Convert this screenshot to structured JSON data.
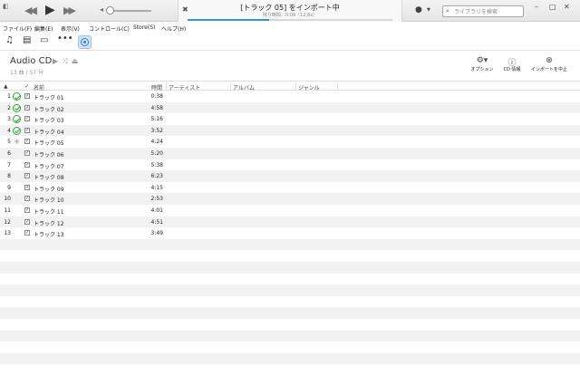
{
  "player": {
    "lcd_title": "[トラック 05] をインポート中",
    "lcd_subtitle": "残り時間：0:09（12.6x）",
    "progress_percent": 40,
    "search_placeholder": "ライブラリを検索"
  },
  "menu": [
    {
      "label": "ファイル(F)"
    },
    {
      "label": "編集(E)"
    },
    {
      "label": "表示(V)"
    },
    {
      "label": "コントロール(C)"
    },
    {
      "label": "Store(S)"
    },
    {
      "label": "ヘルプ(H)"
    }
  ],
  "album": {
    "title": "Audio CD",
    "subtitle": "13 曲 / 57 分"
  },
  "actions": {
    "options": "オプション",
    "cd_info": "CD 情報",
    "stop_import": "インポートを中止"
  },
  "columns": {
    "check": "✓",
    "name": "名前",
    "time": "時間",
    "artist": "アーティスト",
    "album": "アルバム",
    "genre": "ジャンル"
  },
  "tracks": [
    {
      "num": "1",
      "name": "トラック 01",
      "time": "0:38",
      "status": "done"
    },
    {
      "num": "2",
      "name": "トラック 02",
      "time": "4:58",
      "status": "done"
    },
    {
      "num": "3",
      "name": "トラック 03",
      "time": "5:16",
      "status": "done"
    },
    {
      "num": "4",
      "name": "トラック 04",
      "time": "3:52",
      "status": "done"
    },
    {
      "num": "5",
      "name": "トラック 05",
      "time": "4:24",
      "status": "importing"
    },
    {
      "num": "6",
      "name": "トラック 06",
      "time": "5:20",
      "status": "pending"
    },
    {
      "num": "7",
      "name": "トラック 07",
      "time": "5:38",
      "status": "pending"
    },
    {
      "num": "8",
      "name": "トラック 08",
      "time": "6:23",
      "status": "pending"
    },
    {
      "num": "9",
      "name": "トラック 09",
      "time": "4:15",
      "status": "pending"
    },
    {
      "num": "10",
      "name": "トラック 10",
      "time": "2:53",
      "status": "pending"
    },
    {
      "num": "11",
      "name": "トラック 11",
      "time": "4:01",
      "status": "pending"
    },
    {
      "num": "12",
      "name": "トラック 12",
      "time": "4:51",
      "status": "pending"
    },
    {
      "num": "13",
      "name": "トラック 13",
      "time": "3:49",
      "status": "pending"
    }
  ]
}
